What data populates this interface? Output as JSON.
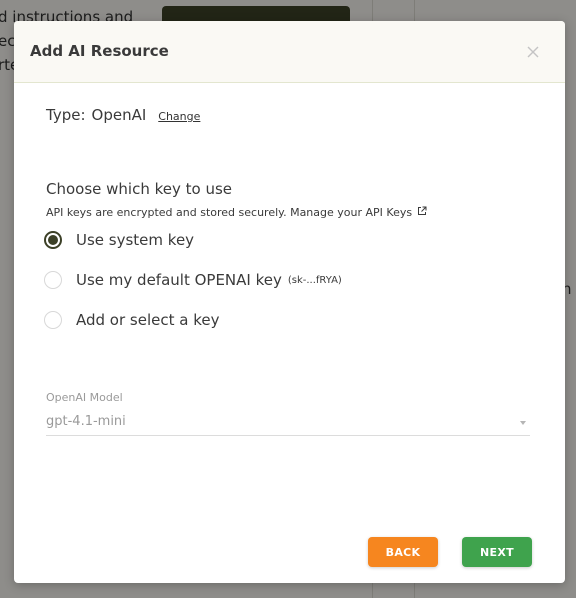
{
  "background": {
    "text_lines": [
      "d instructions and",
      "ec",
      "rte"
    ],
    "right_letter": "n"
  },
  "modal": {
    "title": "Add AI Resource",
    "close_icon": "close-icon",
    "type_label": "Type:",
    "type_value": "OpenAI",
    "change_link": "Change",
    "key_heading": "Choose which key to use",
    "key_subtext": "API keys are encrypted and stored securely. Manage your API Keys",
    "external_link_icon": "external-link-icon",
    "options": [
      {
        "label": "Use system key",
        "hint": "",
        "checked": true
      },
      {
        "label": "Use my default OPENAI key",
        "hint": "(sk-...fRYA)",
        "checked": false
      },
      {
        "label": "Add or select a key",
        "hint": "",
        "checked": false
      }
    ],
    "model_label": "OpenAI Model",
    "model_value": "gpt-4.1-mini",
    "back_button": "BACK",
    "next_button": "NEXT"
  },
  "colors": {
    "accent_dark": "#3c4027",
    "back_orange": "#f6861f",
    "next_green": "#3fa34d"
  }
}
